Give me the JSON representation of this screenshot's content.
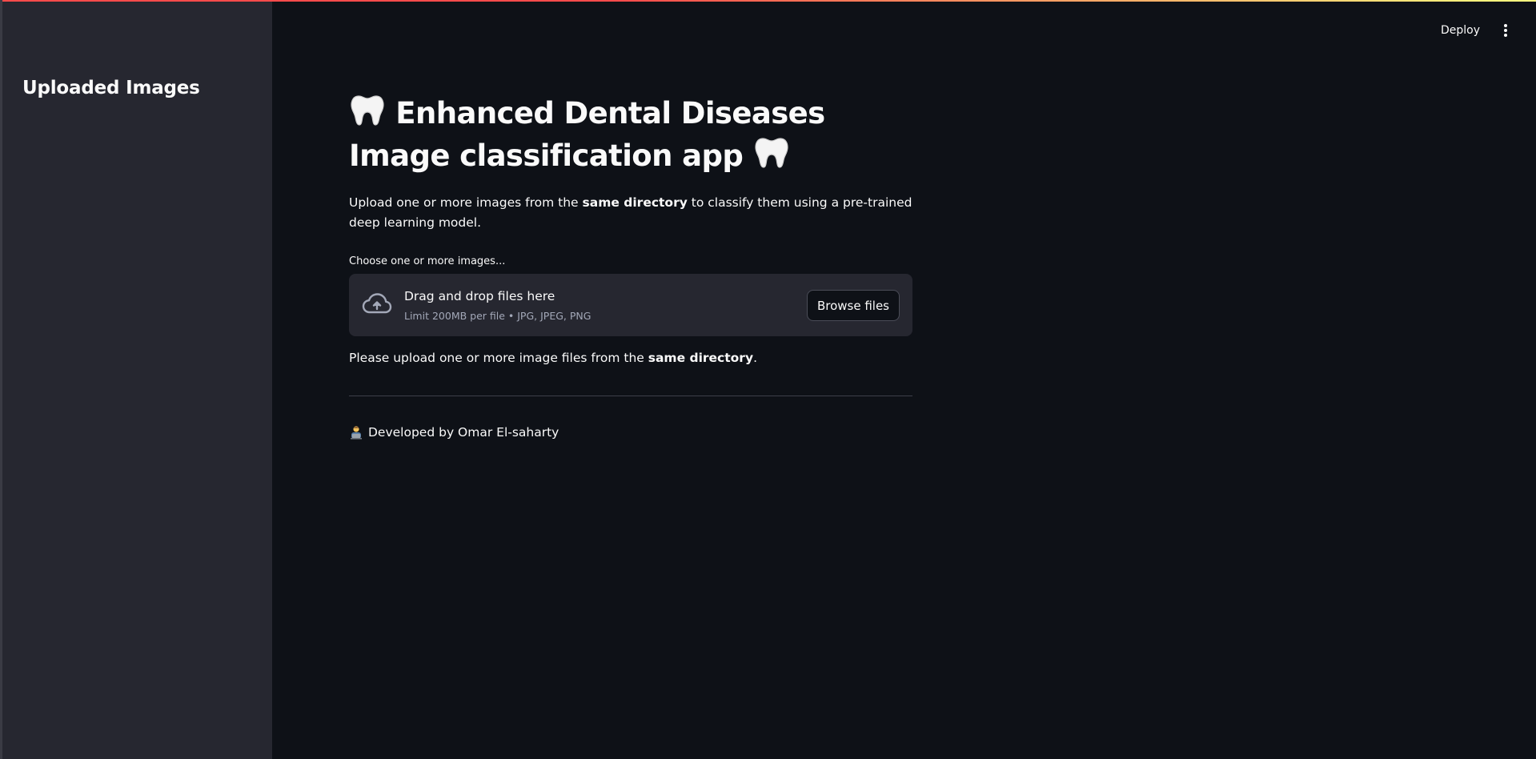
{
  "sidebar": {
    "title": "Uploaded Images"
  },
  "header": {
    "deploy_label": "Deploy",
    "menu_icon": "vertical-dots-icon"
  },
  "main": {
    "title_line": "Enhanced Dental Diseases Image classification app",
    "title_icon": "tooth-icon",
    "intro": {
      "before": "Upload one or more images from the ",
      "bold": "same directory",
      "after": " to classify them using a pre-trained deep learning model."
    },
    "uploader": {
      "label": "Choose one or more images...",
      "icon": "cloud-upload-icon",
      "drop_text": "Drag and drop files here",
      "limit_text": "Limit 200MB per file • JPG, JPEG, PNG",
      "browse_label": "Browse files"
    },
    "note": {
      "before": "Please upload one or more image files from the ",
      "bold": "same directory",
      "after": "."
    },
    "footer": {
      "icon": "developer-icon",
      "text": "Developed by Omar El-saharty"
    }
  },
  "colors": {
    "background": "#0e1117",
    "sidebar": "#262730",
    "text": "#fafafa",
    "muted": "#a3a8b8",
    "accent_line": "#ff4b4b"
  }
}
